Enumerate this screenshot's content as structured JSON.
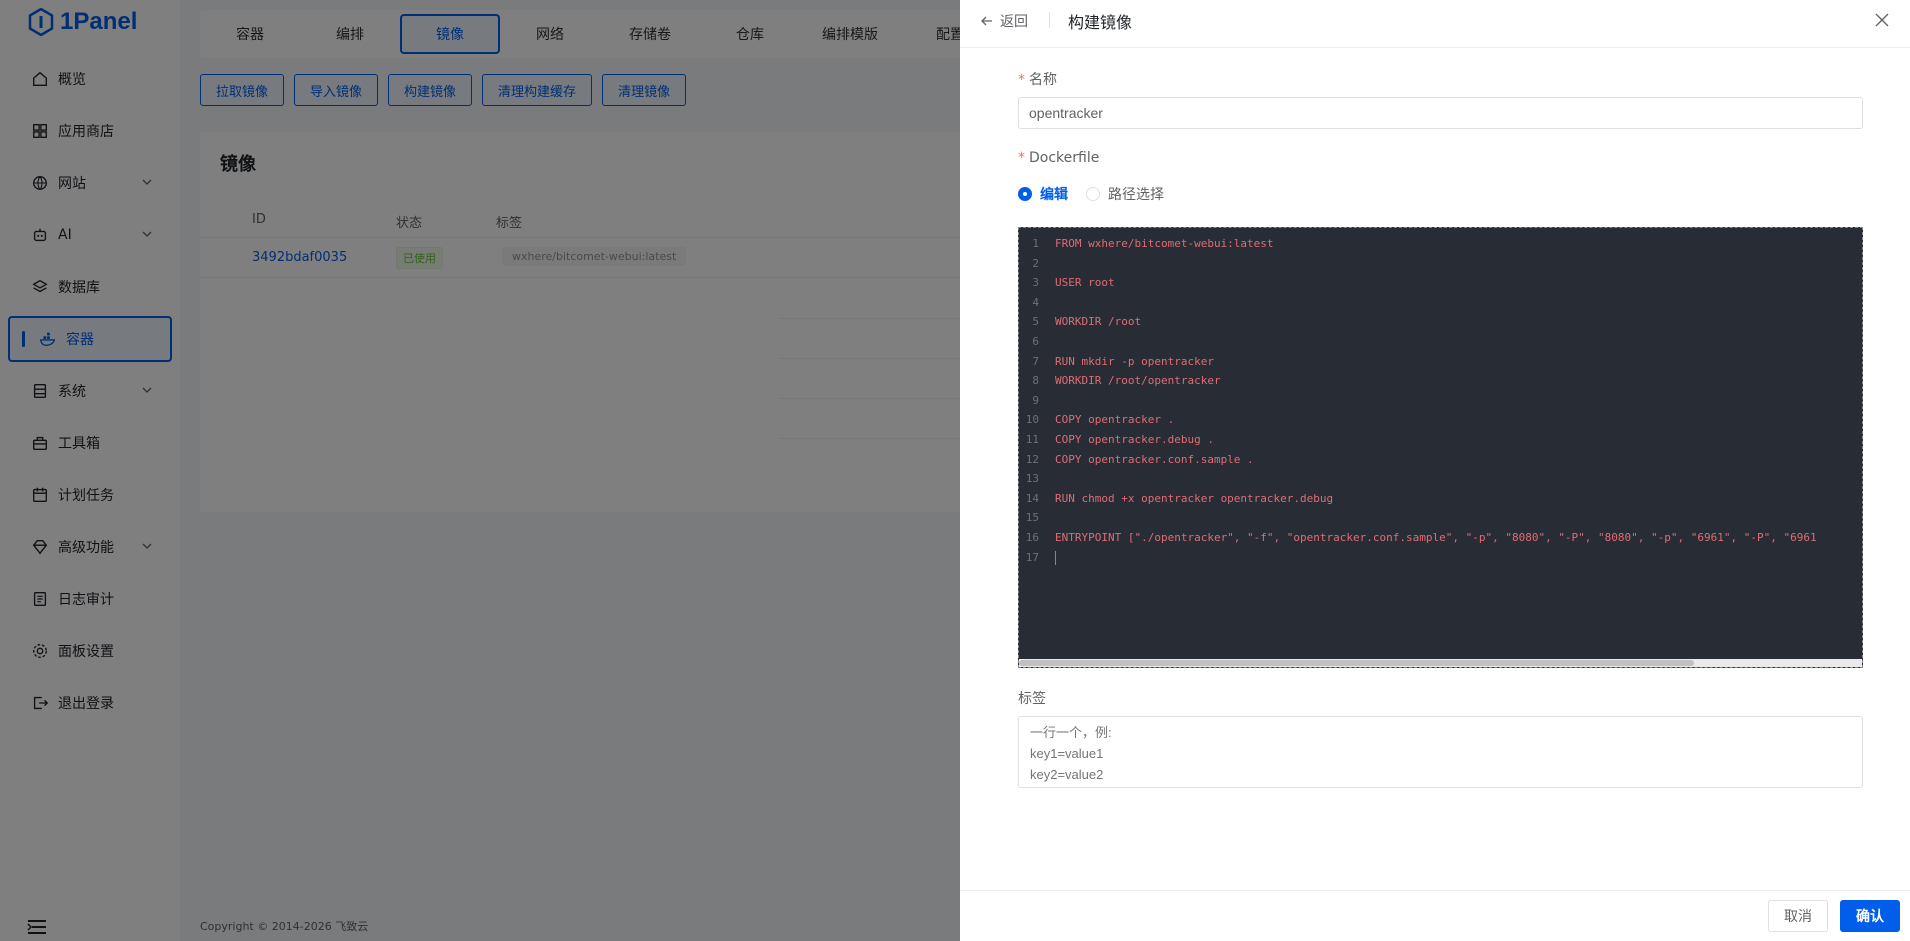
{
  "app": {
    "logo_text": "1Panel",
    "brand_color": "#005eeb"
  },
  "sidebar": {
    "items": [
      {
        "label": "概览",
        "icon": "home-icon"
      },
      {
        "label": "应用商店",
        "icon": "grid-icon"
      },
      {
        "label": "网站",
        "icon": "globe-icon",
        "expandable": true
      },
      {
        "label": "AI",
        "icon": "robot-icon",
        "expandable": true
      },
      {
        "label": "数据库",
        "icon": "layers-icon"
      },
      {
        "label": "容器",
        "icon": "docker-icon",
        "active": true
      },
      {
        "label": "系统",
        "icon": "server-icon",
        "expandable": true
      },
      {
        "label": "工具箱",
        "icon": "toolbox-icon"
      },
      {
        "label": "计划任务",
        "icon": "calendar-icon"
      },
      {
        "label": "高级功能",
        "icon": "diamond-icon",
        "expandable": true
      },
      {
        "label": "日志审计",
        "icon": "log-icon"
      },
      {
        "label": "面板设置",
        "icon": "gear-icon"
      },
      {
        "label": "退出登录",
        "icon": "logout-icon"
      }
    ]
  },
  "topnav": {
    "tabs": [
      "容器",
      "编排",
      "镜像",
      "网络",
      "存储卷",
      "仓库",
      "编排模版",
      "配置"
    ],
    "active": "镜像"
  },
  "actions": [
    "拉取镜像",
    "导入镜像",
    "构建镜像",
    "清理构建缓存",
    "清理镜像"
  ],
  "images_card": {
    "title": "镜像",
    "columns": [
      "ID",
      "状态",
      "标签"
    ],
    "rows": [
      {
        "id": "3492bdaf0035",
        "status": "已使用",
        "tag": "wxhere/bitcomet-webui:latest"
      }
    ]
  },
  "footer": {
    "copyright": "Copyright © 2014-2026 飞致云"
  },
  "drawer": {
    "back_label": "返回",
    "title": "构建镜像",
    "name_label": "名称",
    "name_value": "opentracker",
    "dockerfile_label": "Dockerfile",
    "radio_edit": "编辑",
    "radio_path": "路径选择",
    "code_lines": [
      "FROM wxhere/bitcomet-webui:latest",
      "",
      "USER root",
      "",
      "WORKDIR /root",
      "",
      "RUN mkdir -p opentracker",
      "WORKDIR /root/opentracker",
      "",
      "COPY opentracker .",
      "COPY opentracker.debug .",
      "COPY opentracker.conf.sample .",
      "",
      "RUN chmod +x opentracker opentracker.debug",
      "",
      "ENTRYPOINT [\"./opentracker\", \"-f\", \"opentracker.conf.sample\", \"-p\", \"8080\", \"-P\", \"8080\", \"-p\", \"6961\", \"-P\", \"6961",
      ""
    ],
    "tags_label": "标签",
    "tags_placeholder": "一行一个，例:\nkey1=value1\nkey2=value2",
    "cancel_label": "取消",
    "confirm_label": "确认"
  }
}
